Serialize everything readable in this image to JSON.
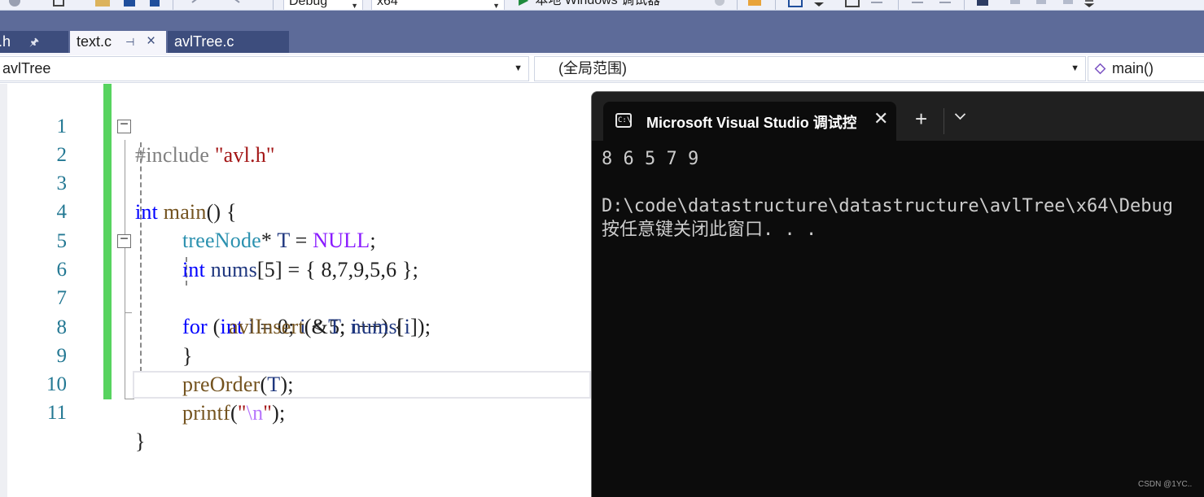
{
  "toolbar": {
    "config_value": "Debug",
    "platform_value": "x64",
    "run_label": "本地 Windows 调试器"
  },
  "tabs": [
    {
      "label": "l.h",
      "pinned": true,
      "active": false
    },
    {
      "label": "text.c",
      "pinned": true,
      "active": true
    },
    {
      "label": "avlTree.c",
      "pinned": false,
      "active": false
    }
  ],
  "navbar": {
    "project": "avlTree",
    "scope": "(全局范围)",
    "member": "main()"
  },
  "editor": {
    "line_numbers": [
      "1",
      "2",
      "3",
      "4",
      "5",
      "6",
      "7",
      "8",
      "9",
      "10",
      "11"
    ],
    "code": {
      "l1_pp": "#include ",
      "l1_str": "\"avl.h\"",
      "l2_kw": "int",
      "l2_fn": "main",
      "l2_rest": "() {",
      "l4_ty": "treeNode",
      "l4_op": "* ",
      "l4_var": "T",
      "l4_eq": " = ",
      "l4_macro": "NULL",
      "l4_end": ";",
      "l5_kw": "int",
      "l5_var": "nums",
      "l5_rest": "[5] = { 8,7,9,5,6 };",
      "l6_kw": "for",
      "l6_open": " (",
      "l6_kw2": "int",
      "l6_i": "i",
      "l6_mid": " = 0; ",
      "l6_i2": "i",
      "l6_cmp": " < 5; ",
      "l6_i3": "i",
      "l6_end": "++) {",
      "l7_fn": "avlInsert",
      "l7_a": "(&",
      "l7_T": "T",
      "l7_b": ", ",
      "l7_nums": "nums",
      "l7_c": "[",
      "l7_i": "i",
      "l7_d": "]);",
      "l8_brace": "}",
      "l9_fn": "preOrder",
      "l9_a": "(",
      "l9_T": "T",
      "l9_b": ");",
      "l10_fn": "printf",
      "l10_a": "(",
      "l10_q1": "\"",
      "l10_esc": "\\n",
      "l10_q2": "\"",
      "l10_b": ");",
      "l11_brace": "}"
    }
  },
  "console": {
    "title": "Microsoft Visual Studio 调试控制台",
    "icon_text": "C:\\",
    "new_tab": "+",
    "lines": [
      "8 6 5 7 9",
      "",
      "D:\\code\\datastructure\\datastructure\\avlTree\\x64\\Debug",
      "按任意键关闭此窗口. . ."
    ]
  },
  "watermark": "CSDN @1YC.."
}
